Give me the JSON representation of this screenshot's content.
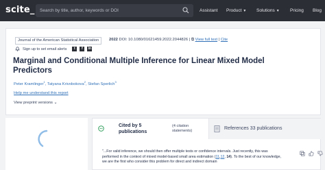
{
  "topbar": {
    "logo": "scite_",
    "search_placeholder": "Search by title, author, keywords or DOI",
    "nav": [
      {
        "label": "Assistant",
        "has_menu": false
      },
      {
        "label": "Product",
        "has_menu": true
      },
      {
        "label": "Solutions",
        "has_menu": true
      },
      {
        "label": "Pricing",
        "has_menu": false
      },
      {
        "label": "Blog",
        "has_menu": false
      }
    ]
  },
  "paper": {
    "journal": "Journal of the American Statistical Association",
    "year": "2022",
    "doi": "DOI: 10.1080/01621459.2022.2044826",
    "full_text": "View full text",
    "cite": "Cite",
    "alerts": "Sign up to set email alerts",
    "title": "Marginal and Conditional Multiple Inference for Linear Mixed Model Predictors",
    "authors": [
      {
        "name": "Peter Kramlinger",
        "sup": "1"
      },
      {
        "name": "Tatyana Krivobokova",
        "sup": "2"
      },
      {
        "name": "Stefan Sperlich",
        "sup": "3"
      }
    ],
    "help": "Help me understand this report",
    "preprint": "View preprint versions"
  },
  "citations": {
    "cited_label": "Cited by 5 publications",
    "cited_statements": "(4 citation statements)",
    "refs_label": "References 33 publications",
    "excerpt_start": "\"...For valid inference, we should then offer multiple tests or confidence intervals. Just recently, this was performed in the context of mixed model-based small area estimation (",
    "ref1": "11",
    "ref2": "12",
    "ref3": "14",
    "excerpt_end": "). To the best of our knowledge, we are the first who consider this problem for direct and indirect domain"
  },
  "colors": {
    "topbar": "#2c2e36",
    "link": "#2e6fb7",
    "accent_green": "#2f9e5b"
  }
}
